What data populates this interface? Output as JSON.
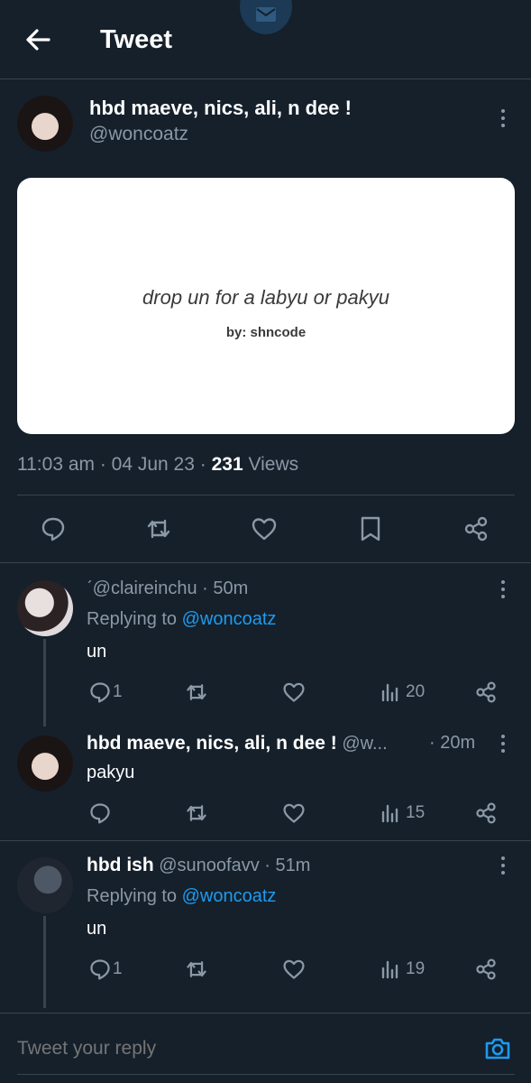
{
  "header": {
    "title": "Tweet"
  },
  "tweet": {
    "author_name": "hbd maeve, nics, ali, n dee !",
    "author_handle": "@woncoatz",
    "media": {
      "text_main": "drop un for a labyu or pakyu",
      "text_sub": "by: shncode"
    },
    "time": "11:03 am",
    "date": "04 Jun 23",
    "views_count": "231",
    "views_label": "Views"
  },
  "replies": [
    {
      "handle": "ˊ@claireinchu",
      "time": "50m",
      "replying_to_label": "Replying to",
      "replying_to": "@woncoatz",
      "text": "un",
      "reply_count": "1",
      "views": "20"
    },
    {
      "name": "hbd maeve, nics, ali, n dee !",
      "handle": "@w...",
      "time": "20m",
      "text": "pakyu",
      "views": "15"
    },
    {
      "name": "hbd ish",
      "handle": "@sunoofavv",
      "time": "51m",
      "replying_to_label": "Replying to",
      "replying_to": "@woncoatz",
      "text": "un",
      "reply_count": "1",
      "views": "19"
    }
  ],
  "composer": {
    "placeholder": "Tweet your reply"
  },
  "colors": {
    "background": "#15202b",
    "accent": "#1d9bf0",
    "muted": "#8b98a5",
    "divider": "#38444d"
  }
}
